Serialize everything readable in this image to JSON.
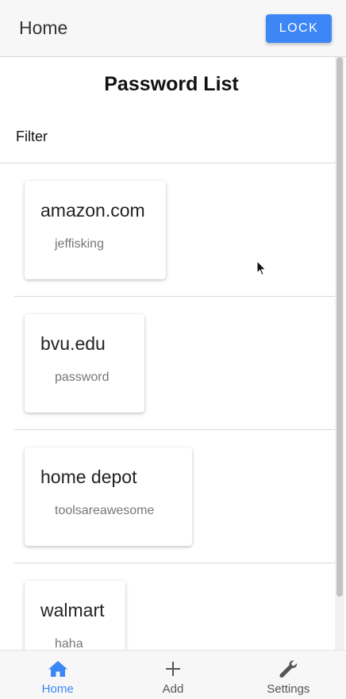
{
  "header": {
    "title": "Home",
    "lock_label": "LOCK"
  },
  "page": {
    "title": "Password List",
    "filter_label": "Filter"
  },
  "passwords": [
    {
      "site": "amazon.com",
      "username": "jeffisking"
    },
    {
      "site": "bvu.edu",
      "username": "password"
    },
    {
      "site": "home depot",
      "username": "toolsareawesome"
    },
    {
      "site": "walmart",
      "username": "haha"
    }
  ],
  "bottom_nav": {
    "home": {
      "label": "Home",
      "icon": "home-icon"
    },
    "add": {
      "label": "Add",
      "icon": "plus-icon"
    },
    "settings": {
      "label": "Settings",
      "icon": "wrench-icon"
    }
  },
  "colors": {
    "accent": "#3d86f6",
    "header_bg": "#f7f7f7"
  }
}
